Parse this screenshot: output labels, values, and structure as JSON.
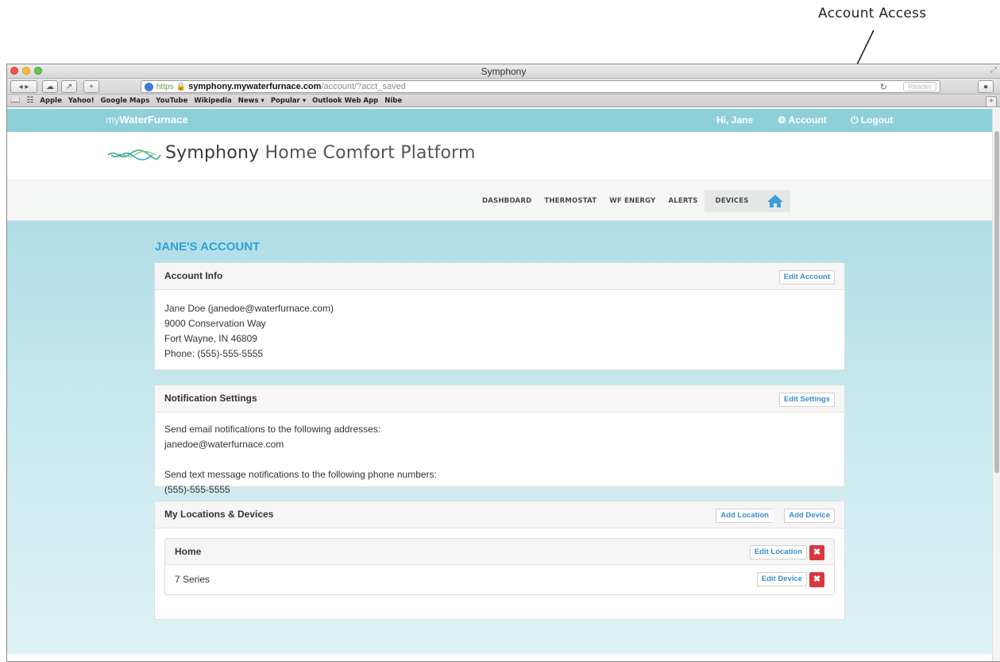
{
  "annotation": {
    "label": "Account Access"
  },
  "window": {
    "title": "Symphony"
  },
  "toolbar": {
    "url_scheme": "https",
    "url_host": "symphony.mywaterfurnace.com",
    "url_path": "/account/?acct_saved",
    "reader_label": "Reader"
  },
  "bookmarks": [
    "Apple",
    "Yahoo!",
    "Google Maps",
    "YouTube",
    "Wikipedia",
    "News ▾",
    "Popular ▾",
    "Outlook Web App",
    "Nibe"
  ],
  "topbar": {
    "brand_prefix": "my",
    "brand_name": "WaterFurnace",
    "greeting": "Hi, Jane",
    "account_label": "Account",
    "logout_label": "Logout"
  },
  "logo": {
    "brand": "Symphony",
    "tagline": "Home Comfort Platform"
  },
  "nav": {
    "items": [
      "DASHBOARD",
      "THERMOSTAT",
      "WF ENERGY",
      "ALERTS",
      "DEVICES"
    ]
  },
  "page": {
    "heading": "JANE'S ACCOUNT"
  },
  "account_info": {
    "title": "Account Info",
    "edit_label": "Edit Account",
    "lines": [
      "Jane Doe (janedoe@waterfurnace.com)",
      "9000 Conservation Way",
      "Fort Wayne, IN 46809",
      "Phone: (555)-555-5555"
    ]
  },
  "notifications": {
    "title": "Notification Settings",
    "edit_label": "Edit Settings",
    "email_intro": "Send email notifications to the following addresses:",
    "email": "janedoe@waterfurnace.com",
    "sms_intro": "Send text message notifications to the following phone numbers:",
    "phone": "(555)-555-5555"
  },
  "locations": {
    "title": "My Locations & Devices",
    "add_location_label": "Add Location",
    "add_device_label": "Add Device",
    "location": {
      "name": "Home",
      "edit_label": "Edit Location",
      "device_name": "7 Series",
      "edit_device_label": "Edit Device"
    }
  },
  "colors": {
    "topbar": "#8fd0d8",
    "heading": "#2fa2d6",
    "delete": "#d9373e",
    "link": "#3b8ccf"
  }
}
